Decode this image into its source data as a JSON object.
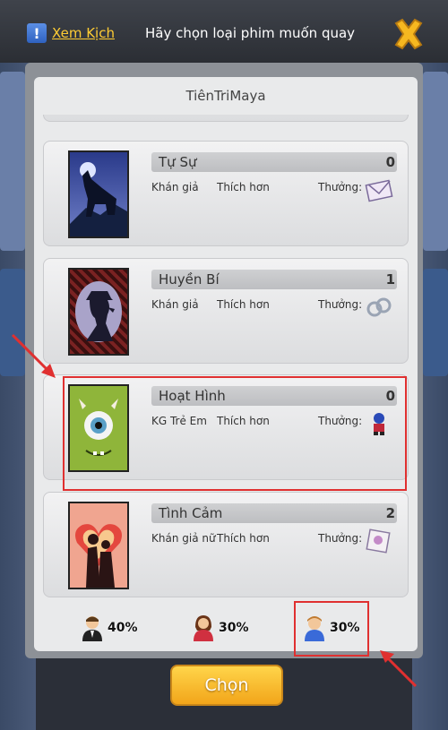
{
  "header": {
    "xem_kich_label": "Xem Kịch",
    "title": "Hãy chọn loại phim muốn quay"
  },
  "list": {
    "title": "TiênTriMaya",
    "items": [
      {
        "name": "Tự Sự",
        "count": "0",
        "audience": "Khán giả",
        "preference": "Thích hơn",
        "reward_label": "Thưởng:",
        "reward_icon": "envelope-icon",
        "poster": "wolf-poster"
      },
      {
        "name": "Huyền Bí",
        "count": "1",
        "audience": "Khán giả",
        "preference": "Thích hơn",
        "reward_label": "Thưởng:",
        "reward_icon": "handcuffs-icon",
        "poster": "detective-poster"
      },
      {
        "name": "Hoạt Hình",
        "count": "0",
        "audience": "KG Trẻ Em",
        "preference": "Thích hơn",
        "reward_label": "Thưởng:",
        "reward_icon": "robot-figure-icon",
        "poster": "one-eyed-monster-poster"
      },
      {
        "name": "Tình Cảm",
        "count": "2",
        "audience": "Khán giả nữ",
        "preference": "Thích hơn",
        "reward_label": "Thưởng:",
        "reward_icon": "photo-frame-icon",
        "poster": "couple-heart-poster"
      }
    ]
  },
  "stats": [
    {
      "icon": "man-avatar-icon",
      "value": "40%"
    },
    {
      "icon": "woman-avatar-icon",
      "value": "30%"
    },
    {
      "icon": "child-avatar-icon",
      "value": "30%"
    }
  ],
  "choose_button": "Chọn",
  "colors": {
    "accent_yellow": "#ffcc33",
    "highlight_red": "#e03030",
    "button_orange": "#f2a51a"
  }
}
